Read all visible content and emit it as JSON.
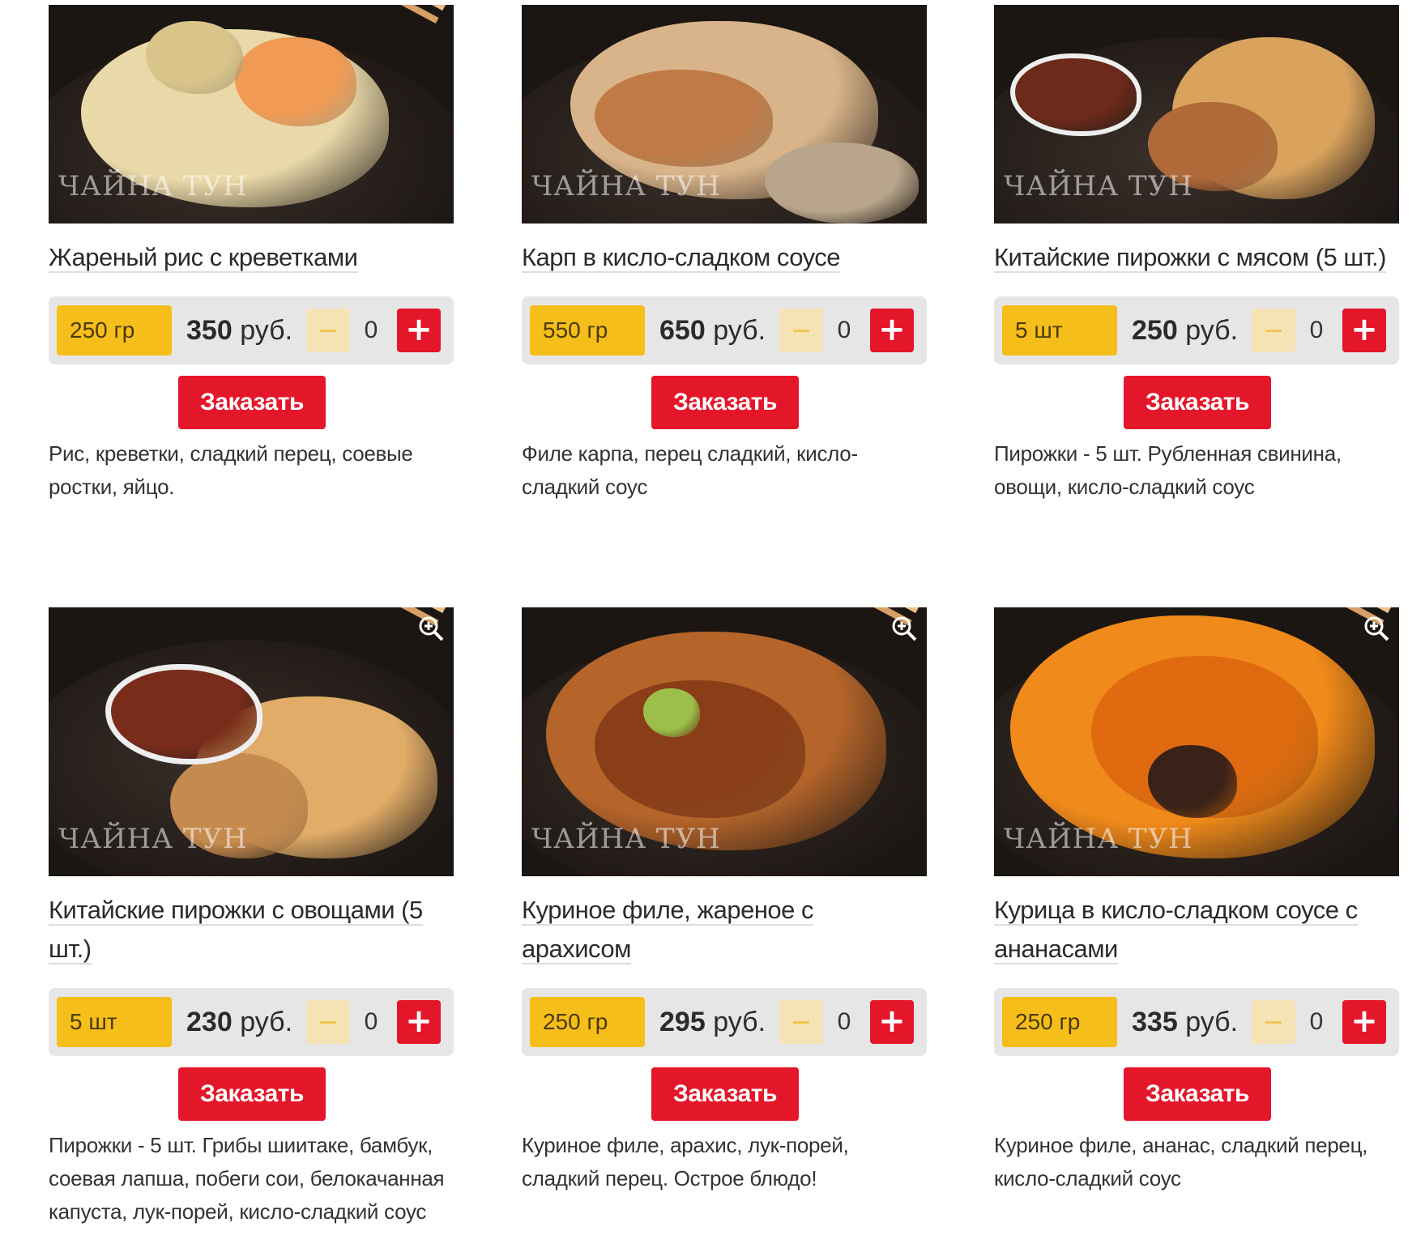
{
  "logo_text": "ЧАЙНА ТУН",
  "products": [
    {
      "title": "Жареный рис с креветками",
      "weight": "250 гр",
      "price_value": "350",
      "price_currency": "руб.",
      "quantity": "0",
      "order_label": "Заказать",
      "description": "Рис, креветки, сладкий перец, соевые ростки, яйцо.",
      "zoom": false,
      "colors": [
        "#e9d9a9",
        "#f09a55",
        "#d9c48a"
      ]
    },
    {
      "title": "Карп в кисло-сладком соусе",
      "weight": "550 гр",
      "price_value": "650",
      "price_currency": "руб.",
      "quantity": "0",
      "order_label": "Заказать",
      "description": "Филе карпа, перец сладкий, кисло-сладкий соус",
      "zoom": false,
      "colors": [
        "#d9b48a",
        "#c07a45",
        "#b8a58b"
      ]
    },
    {
      "title": "Китайские пирожки с мясом (5 шт.)",
      "weight": "5 шт",
      "price_value": "250",
      "price_currency": "руб.",
      "quantity": "0",
      "order_label": "Заказать",
      "description": "Пирожки - 5 шт. Рубленная свинина, овощи, кисло-сладкий соус",
      "zoom": false,
      "colors": [
        "#d9a35e",
        "#b06a3a",
        "#6b2a1a"
      ]
    },
    {
      "title": "Китайские пирожки с овощами (5 шт.)",
      "weight": "5 шт",
      "price_value": "230",
      "price_currency": "руб.",
      "quantity": "0",
      "order_label": "Заказать",
      "description": "Пирожки - 5 шт. Грибы шиитаке, бамбук, соевая лапша, побеги сои, белокачанная капуста, лук-порей, кисло-сладкий соус",
      "zoom": true,
      "colors": [
        "#e0ac68",
        "#c48a4e",
        "#7a2c1a"
      ]
    },
    {
      "title": "Куриное филе, жареное с арахисом",
      "weight": "250 гр",
      "price_value": "295",
      "price_currency": "руб.",
      "quantity": "0",
      "order_label": "Заказать",
      "description": "Куриное филе, арахис, лук-порей, сладкий перец. Острое блюдо!",
      "zoom": true,
      "colors": [
        "#b5652a",
        "#8a3e18",
        "#9bbf4a"
      ]
    },
    {
      "title": "Курица в кисло-сладком соусе с ананасами",
      "weight": "250 гр",
      "price_value": "335",
      "price_currency": "руб.",
      "quantity": "0",
      "order_label": "Заказать",
      "description": "Куриное филе, ананас, сладкий перец, кисло-сладкий соус",
      "zoom": true,
      "colors": [
        "#f08a1a",
        "#e06a10",
        "#3a2218"
      ]
    }
  ]
}
